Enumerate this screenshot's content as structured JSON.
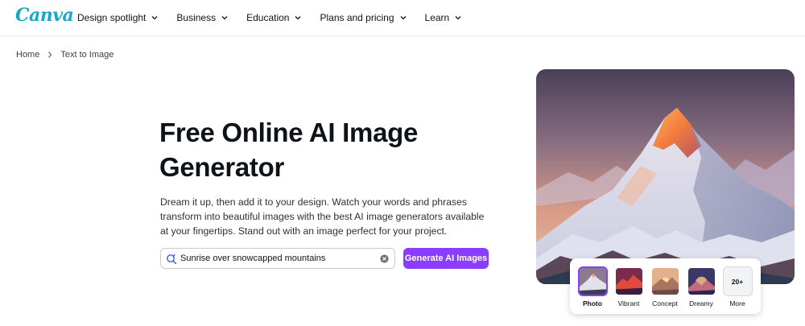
{
  "brand": {
    "logo_text": "Canva",
    "accent": "#8b3dff",
    "logo_color": "#16a8c4"
  },
  "nav": {
    "items": [
      {
        "label": "Design spotlight",
        "icon": "chevron-down-icon"
      },
      {
        "label": "Business",
        "icon": "chevron-down-icon"
      },
      {
        "label": "Education",
        "icon": "chevron-down-icon"
      },
      {
        "label": "Plans and pricing",
        "icon": "chevron-down-icon"
      },
      {
        "label": "Learn",
        "icon": "chevron-down-icon"
      }
    ]
  },
  "breadcrumb": {
    "home": "Home",
    "current": "Text to Image",
    "separator_icon": "chevron-right-icon"
  },
  "hero": {
    "title": "Free Online AI Image Generator",
    "description": "Dream it up, then add it to your design. Watch your words and phrases transform into beautiful images with the best AI image generators available at your fingertips. Stand out with an image perfect for your project."
  },
  "prompt": {
    "value": "Sunrise over snowcapped mountains",
    "search_icon": "sparkle-search-icon",
    "clear_icon": "clear-circle-icon"
  },
  "generate_button": {
    "label": "Generate AI Images"
  },
  "styles": {
    "options": [
      {
        "label": "Photo",
        "selected": true
      },
      {
        "label": "Vibrant",
        "selected": false
      },
      {
        "label": "Concept",
        "selected": false
      },
      {
        "label": "Dreamy",
        "selected": false
      }
    ],
    "more": {
      "badge": "20+",
      "label": "More"
    }
  }
}
